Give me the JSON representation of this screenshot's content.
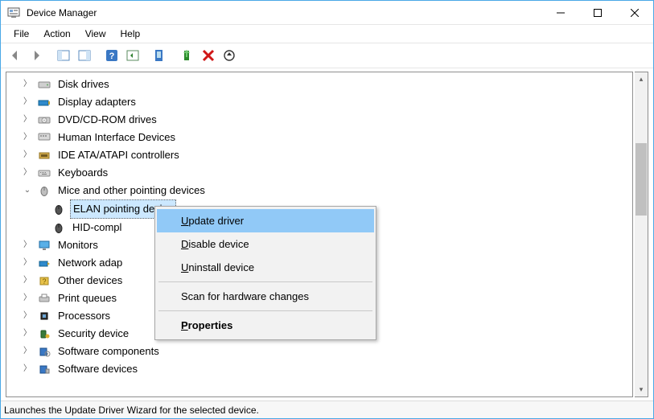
{
  "window": {
    "title": "Device Manager"
  },
  "menubar": {
    "items": [
      "File",
      "Action",
      "View",
      "Help"
    ]
  },
  "toolbar": {
    "buttons": [
      {
        "name": "back-icon"
      },
      {
        "name": "forward-icon"
      },
      {
        "name": "show-hide-tree-icon"
      },
      {
        "name": "show-hide-icon"
      },
      {
        "name": "help-icon"
      },
      {
        "name": "show-hide-action-pane-icon"
      },
      {
        "name": "show-hidden-devices-icon"
      },
      {
        "name": "update-driver-icon"
      },
      {
        "name": "uninstall-icon"
      },
      {
        "name": "scan-hardware-icon"
      }
    ]
  },
  "tree": {
    "items": [
      {
        "label": "Disk drives",
        "expanded": false,
        "icon": "disk-drive-icon"
      },
      {
        "label": "Display adapters",
        "expanded": false,
        "icon": "display-adapter-icon"
      },
      {
        "label": "DVD/CD-ROM drives",
        "expanded": false,
        "icon": "optical-drive-icon"
      },
      {
        "label": "Human Interface Devices",
        "expanded": false,
        "icon": "hid-icon"
      },
      {
        "label": "IDE ATA/ATAPI controllers",
        "expanded": false,
        "icon": "ide-controller-icon"
      },
      {
        "label": "Keyboards",
        "expanded": false,
        "icon": "keyboard-icon"
      },
      {
        "label": "Mice and other pointing devices",
        "expanded": true,
        "icon": "mouse-icon",
        "children": [
          {
            "label": "ELAN pointing device",
            "icon": "mouse-icon",
            "selected": true
          },
          {
            "label": "HID-compl",
            "icon": "mouse-icon",
            "truncated": true
          }
        ]
      },
      {
        "label": "Monitors",
        "expanded": false,
        "icon": "monitor-icon"
      },
      {
        "label": "Network adap",
        "expanded": false,
        "icon": "network-adapter-icon",
        "truncated": true
      },
      {
        "label": "Other devices",
        "expanded": false,
        "icon": "other-devices-icon"
      },
      {
        "label": "Print queues",
        "expanded": false,
        "icon": "printer-icon"
      },
      {
        "label": "Processors",
        "expanded": false,
        "icon": "processor-icon"
      },
      {
        "label": "Security device",
        "expanded": false,
        "icon": "security-device-icon",
        "truncated": true
      },
      {
        "label": "Software components",
        "expanded": false,
        "icon": "software-component-icon"
      },
      {
        "label": "Software devices",
        "expanded": false,
        "icon": "software-device-icon"
      }
    ]
  },
  "context_menu": {
    "items": [
      {
        "label": "Update driver",
        "mnemonic": "U",
        "highlight": true
      },
      {
        "label": "Disable device",
        "mnemonic": "D"
      },
      {
        "label": "Uninstall device",
        "mnemonic": "U"
      },
      {
        "separator": true
      },
      {
        "label": "Scan for hardware changes"
      },
      {
        "separator": true
      },
      {
        "label": "Properties",
        "mnemonic": "P",
        "bold": true
      }
    ]
  },
  "statusbar": {
    "text": "Launches the Update Driver Wizard for the selected device."
  }
}
